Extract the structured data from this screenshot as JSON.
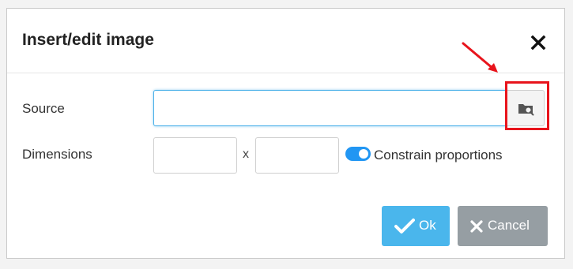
{
  "dialog": {
    "title": "Insert/edit image",
    "close_icon": "close-icon"
  },
  "form": {
    "source": {
      "label": "Source",
      "value": "",
      "placeholder": "",
      "browse_icon": "folder-search-icon"
    },
    "dimensions": {
      "label": "Dimensions",
      "width_value": "",
      "height_value": "",
      "separator": "x",
      "constrain_label": "Constrain proportions",
      "constrain_enabled": true
    }
  },
  "buttons": {
    "ok_label": "Ok",
    "ok_icon": "checkmark-icon",
    "cancel_label": "Cancel",
    "cancel_icon": "x-icon"
  },
  "colors": {
    "accent": "#4ab6ec",
    "toggle_on": "#2196f3",
    "cancel": "#969ea3",
    "annotation": "#e8141c"
  }
}
